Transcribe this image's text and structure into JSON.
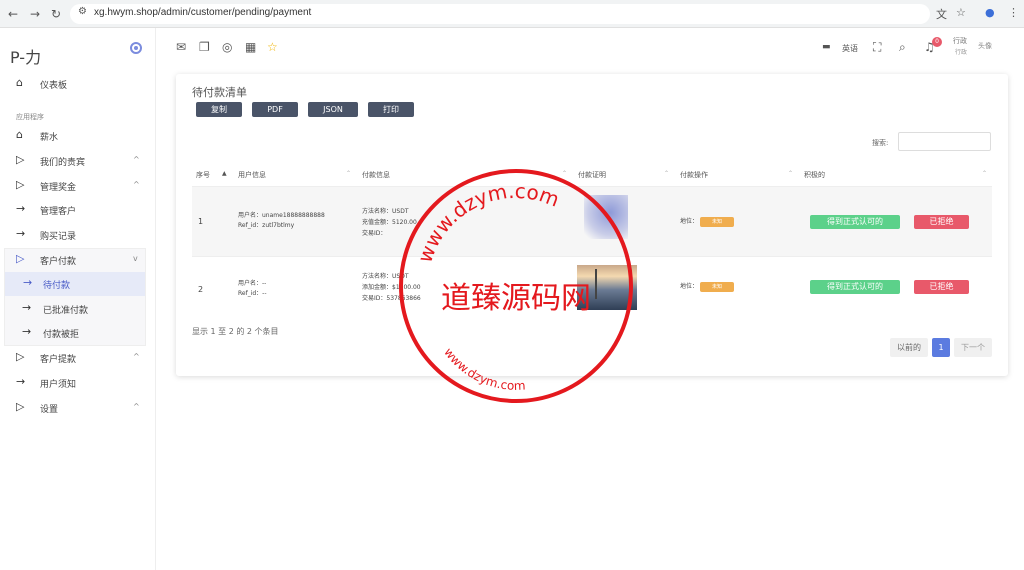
{
  "browser": {
    "url": "xg.hwym.shop/admin/customer/pending/payment"
  },
  "sidebar": {
    "logo": "P-力",
    "dashboard": "仪表板",
    "section_label": "应用程序",
    "items": [
      {
        "label": "薪水"
      },
      {
        "label": "我们的贵宾"
      },
      {
        "label": "管理奖金"
      },
      {
        "label": "管理客户"
      },
      {
        "label": "购买记录"
      },
      {
        "label": "客户付款"
      },
      {
        "label": "待付款"
      },
      {
        "label": "已批准付款"
      },
      {
        "label": "付款被拒"
      },
      {
        "label": "客户提款"
      },
      {
        "label": "用户须知"
      },
      {
        "label": "设置"
      }
    ]
  },
  "header": {
    "language": "英语",
    "notification_count": "0",
    "user_role_line1": "行政",
    "user_role_line2": "行政",
    "avatar_alt": "头像"
  },
  "card": {
    "title": "待付款清单",
    "export_buttons": [
      "复制",
      "PDF",
      "JSON",
      "打印"
    ],
    "search_label": "搜索:",
    "columns": [
      "序号",
      "用户信息",
      "付款信息",
      "付款证明",
      "付款操作",
      "积极的"
    ],
    "rows": [
      {
        "seq": "1",
        "user_line1": "用户名：uname18888888888",
        "user_line2": "Ref_id：zutl7btlmy",
        "pay_line1": "方法名称：USDT",
        "pay_line2": "充值金额：5120.00",
        "pay_line3": "交易ID：",
        "action_label": "地位：",
        "tag": "未知",
        "approve": "得到正式认可的",
        "reject": "已拒绝"
      },
      {
        "seq": "2",
        "user_line1": "用户名：--",
        "user_line2": "Ref_id：--",
        "pay_line1": "方法名称：USDT",
        "pay_line2": "添加金额：$1000.00",
        "pay_line3": "交易ID：537863866",
        "action_label": "地位：",
        "tag": "未知",
        "approve": "得到正式认可的",
        "reject": "已拒绝"
      }
    ],
    "footer_info": "显示 1 至 2 的 2 个条目",
    "pagination": {
      "prev": "以前的",
      "current": "1",
      "next": "下一个"
    }
  },
  "watermark": {
    "text": "道臻源码网",
    "ring_top": "www.dzym.com",
    "ring_bottom": "www.dzym.com"
  }
}
